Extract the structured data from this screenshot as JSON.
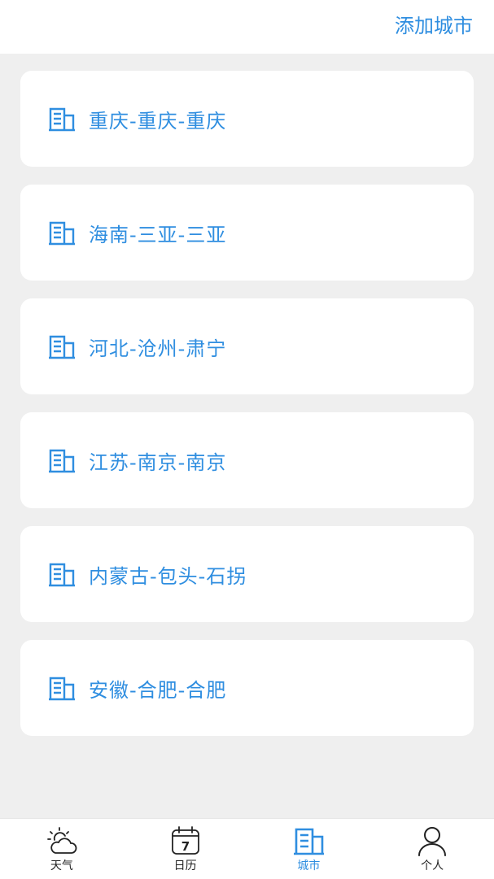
{
  "header": {
    "add_city_label": "添加城市"
  },
  "cities": [
    {
      "label": "重庆-重庆-重庆"
    },
    {
      "label": "海南-三亚-三亚"
    },
    {
      "label": "河北-沧州-肃宁"
    },
    {
      "label": "江苏-南京-南京"
    },
    {
      "label": "内蒙古-包头-石拐"
    },
    {
      "label": "安徽-合肥-合肥"
    }
  ],
  "tabbar": {
    "tabs": [
      {
        "label": "天气",
        "icon": "weather-icon"
      },
      {
        "label": "日历",
        "icon": "calendar-icon",
        "day": "7"
      },
      {
        "label": "城市",
        "icon": "building-icon"
      },
      {
        "label": "个人",
        "icon": "person-icon"
      }
    ],
    "active": "城市"
  },
  "colors": {
    "accent": "#2f8ee0",
    "background": "#efefef",
    "card": "#ffffff",
    "tab_text": "#222222"
  }
}
